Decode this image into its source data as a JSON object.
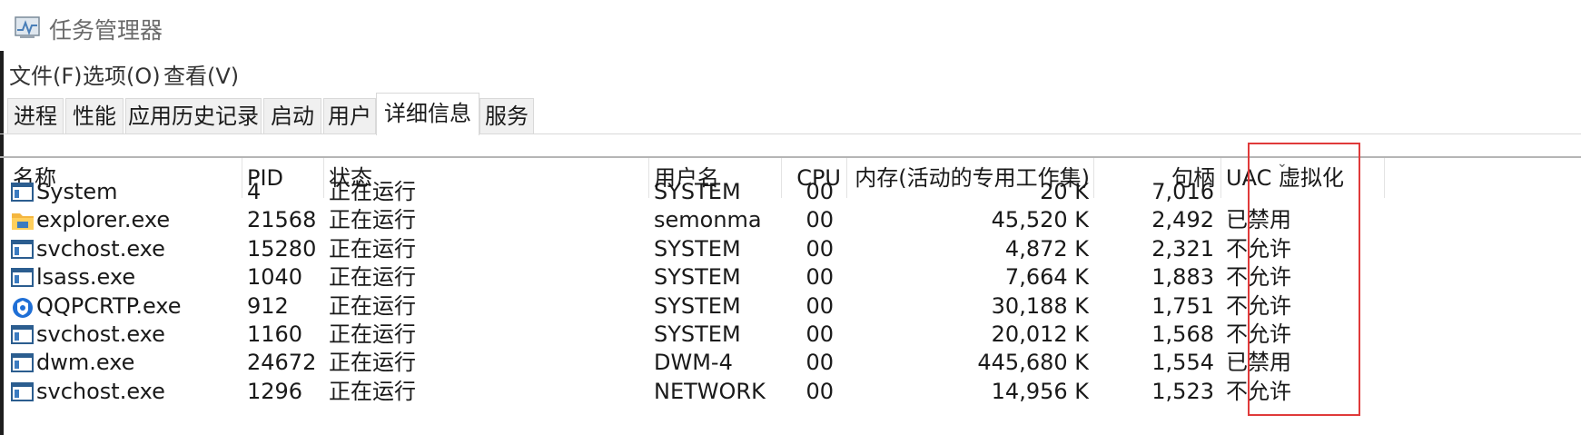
{
  "window": {
    "title": "任务管理器",
    "app_icon": "task-manager-icon"
  },
  "menu": {
    "items": [
      "文件(F)",
      "选项(O)",
      "查看(V)"
    ]
  },
  "tabs": {
    "items": [
      "进程",
      "性能",
      "应用历史记录",
      "启动",
      "用户",
      "详细信息",
      "服务"
    ],
    "active_index": 5
  },
  "table": {
    "columns": [
      "名称",
      "PID",
      "状态",
      "用户名",
      "CPU",
      "内存(活动的专用工作集)",
      "句柄",
      "UAC 虚拟化"
    ],
    "sorted_column": "句柄",
    "sort_direction": "descending",
    "rows": [
      {
        "name": "System",
        "pid": "4",
        "status": "正在运行",
        "user": "SYSTEM",
        "cpu": "00",
        "memory": "20 K",
        "handles": "7,016",
        "uac": "",
        "icon": "window-app-icon"
      },
      {
        "name": "explorer.exe",
        "pid": "21568",
        "status": "正在运行",
        "user": "semonma",
        "cpu": "00",
        "memory": "45,520 K",
        "handles": "2,492",
        "uac": "已禁用",
        "icon": "folder-icon"
      },
      {
        "name": "svchost.exe",
        "pid": "15280",
        "status": "正在运行",
        "user": "SYSTEM",
        "cpu": "00",
        "memory": "4,872 K",
        "handles": "2,321",
        "uac": "不允许",
        "icon": "window-app-icon"
      },
      {
        "name": "lsass.exe",
        "pid": "1040",
        "status": "正在运行",
        "user": "SYSTEM",
        "cpu": "00",
        "memory": "7,664 K",
        "handles": "1,883",
        "uac": "不允许",
        "icon": "window-app-icon"
      },
      {
        "name": "QQPCRTP.exe",
        "pid": "912",
        "status": "正在运行",
        "user": "SYSTEM",
        "cpu": "00",
        "memory": "30,188 K",
        "handles": "1,751",
        "uac": "不允许",
        "icon": "shield-icon"
      },
      {
        "name": "svchost.exe",
        "pid": "1160",
        "status": "正在运行",
        "user": "SYSTEM",
        "cpu": "00",
        "memory": "20,012 K",
        "handles": "1,568",
        "uac": "不允许",
        "icon": "window-app-icon"
      },
      {
        "name": "dwm.exe",
        "pid": "24672",
        "status": "正在运行",
        "user": "DWM-4",
        "cpu": "00",
        "memory": "445,680 K",
        "handles": "1,554",
        "uac": "已禁用",
        "icon": "window-app-icon"
      },
      {
        "name": "svchost.exe",
        "pid": "1296",
        "status": "正在运行",
        "user": "NETWORK",
        "cpu": "00",
        "memory": "14,956 K",
        "handles": "1,523",
        "uac": "不允许",
        "icon": "window-app-icon"
      }
    ]
  },
  "colors": {
    "highlight_border": "#e03a3a",
    "tab_inactive_bg": "#f0f0f0",
    "text": "#1a1a1a"
  }
}
